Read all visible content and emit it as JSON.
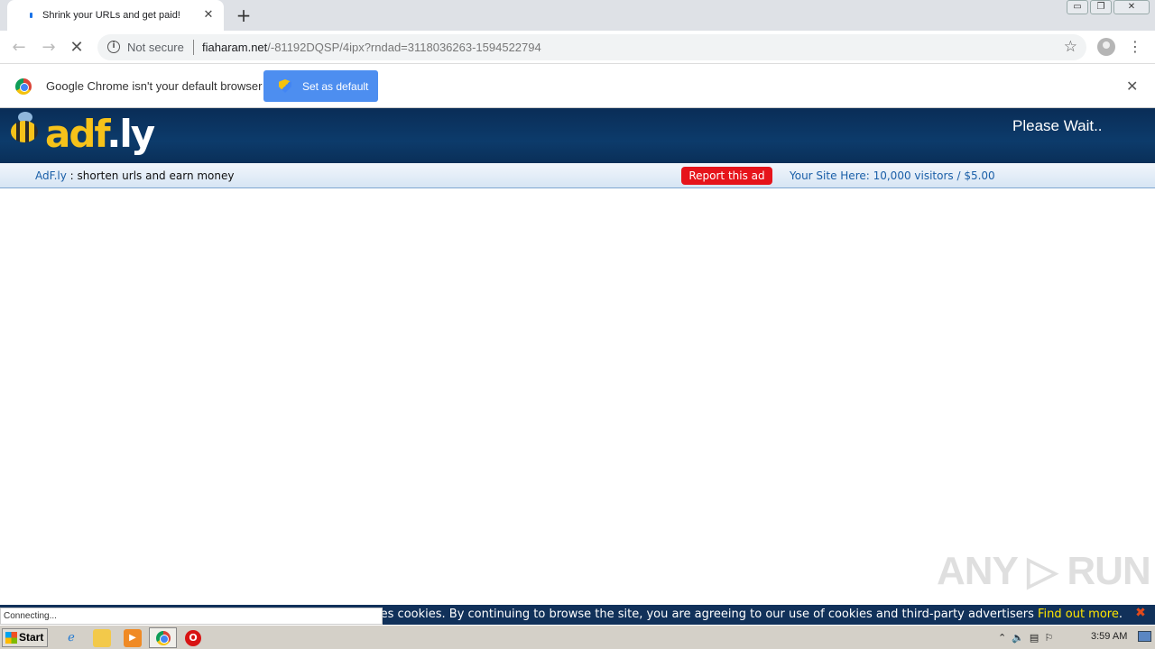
{
  "browser": {
    "tab_title": "Shrink your URLs and get paid!",
    "tab_close": "✕",
    "new_tab": "+",
    "window_buttons": [
      "▭",
      "❐",
      "✕"
    ],
    "security_label": "Not secure",
    "url_host": "fiaharam.net",
    "url_path": "/-81192DQSP/4ipx?rndad=3118036263-1594522794",
    "infobar_text": "Google Chrome isn't your default browser",
    "set_default_label": "Set as default",
    "infobar_close": "✕"
  },
  "adfly": {
    "logo_ad": "adf",
    "logo_fly": ".ly",
    "please_wait": "Please Wait..",
    "tagline_link": "AdF.ly",
    "tagline_text": " : shorten urls and earn money",
    "report_label": "Report this ad",
    "your_site": "Your Site Here: 10,000 visitors / $5.00"
  },
  "cookie": {
    "text": "uses cookies. By continuing to browse the site, you are agreeing to our use of cookies and third-party advertisers ",
    "find_more": "Find out more",
    "period": ".",
    "close": "✖"
  },
  "status_text": "Connecting...",
  "watermark": "ANY ▷ RUN",
  "taskbar": {
    "start_label": "Start",
    "clock": "3:59 AM"
  },
  "colors": {
    "adfly_header": "#0c3b6b",
    "report_red": "#e6141b",
    "cookie_bar": "#11315a",
    "find_more_yellow": "#ffe600",
    "set_default_blue": "#4d8ef0"
  }
}
